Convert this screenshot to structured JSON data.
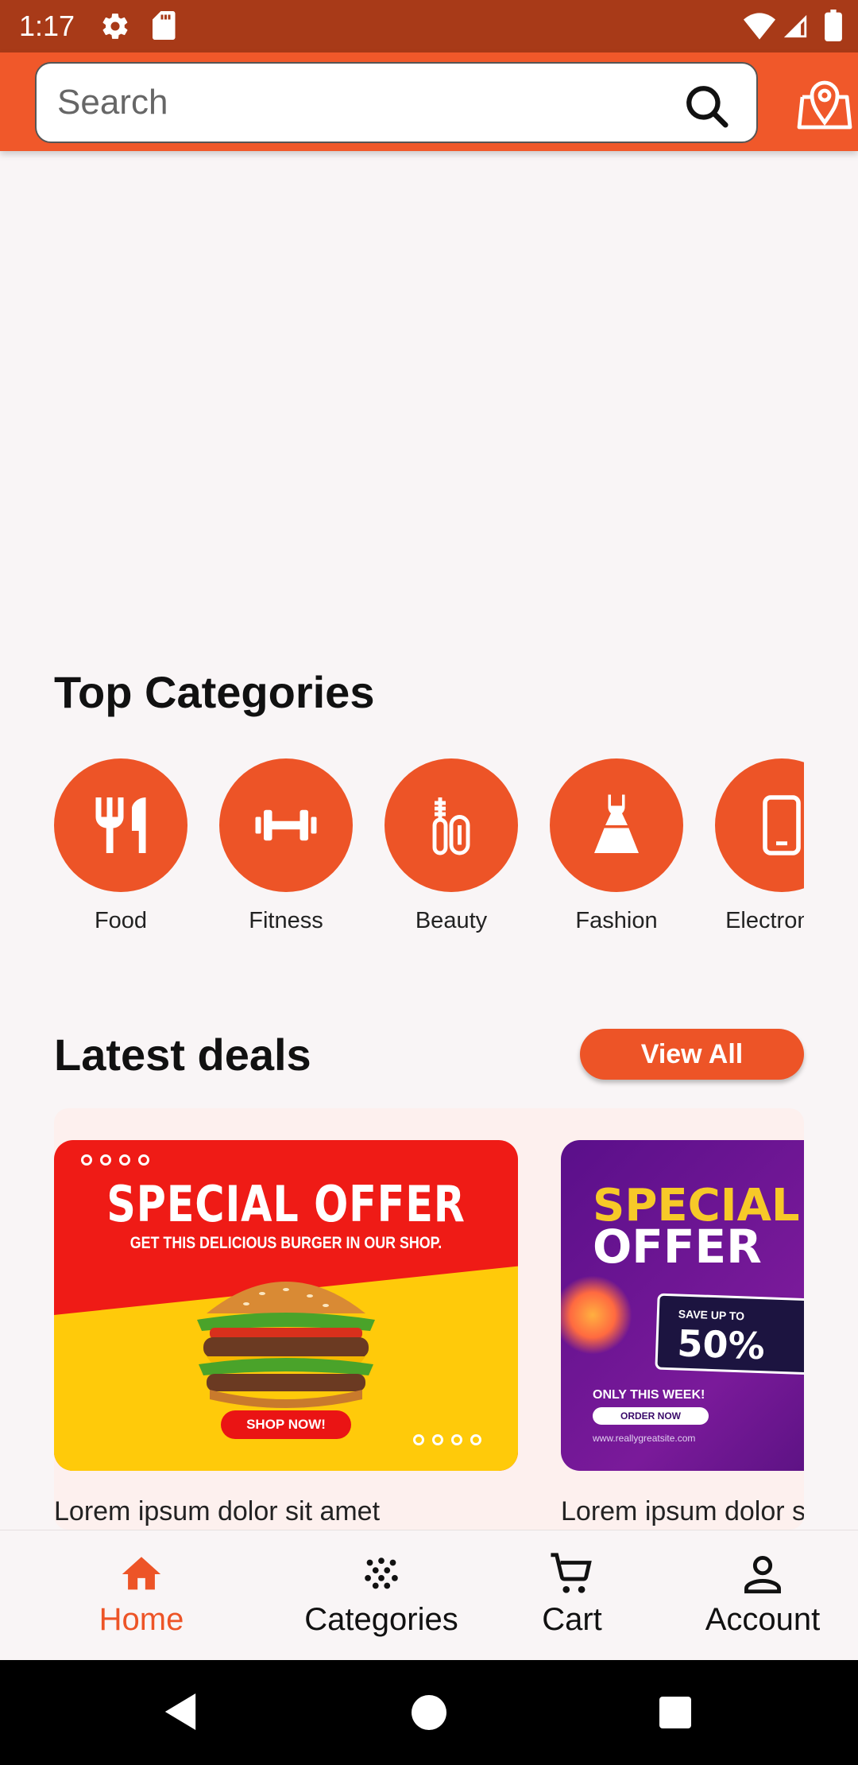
{
  "status_bar": {
    "time": "1:17",
    "icons": [
      "gear-icon",
      "sd-card-icon",
      "wifi-icon",
      "signal-icon",
      "battery-icon"
    ]
  },
  "header": {
    "search_placeholder": "Search",
    "icons": [
      "search-icon",
      "map-location-icon"
    ],
    "accent_color": "#f0582a"
  },
  "top_categories": {
    "title": "Top Categories",
    "items": [
      {
        "label": "Food",
        "icon": "fork-knife-icon"
      },
      {
        "label": "Fitness",
        "icon": "dumbbell-icon"
      },
      {
        "label": "Beauty",
        "icon": "makeup-icon"
      },
      {
        "label": "Fashion",
        "icon": "dress-icon"
      },
      {
        "label": "Electronics",
        "icon": "phone-icon"
      }
    ],
    "circle_color": "#ed5427"
  },
  "latest_deals": {
    "title": "Latest deals",
    "view_all_label": "View All",
    "cards": [
      {
        "headline": "SPECIAL OFFER",
        "subline": "GET THIS DELICIOUS BURGER IN OUR SHOP.",
        "cta": "SHOP NOW!",
        "caption": "Lorem ipsum dolor sit amet"
      },
      {
        "headline_line1": "SPECIAL",
        "headline_line2": "OFFER",
        "save_label": "SAVE UP TO",
        "save_value": "50%",
        "only_label": "ONLY THIS WEEK!",
        "order_label": "ORDER NOW",
        "site": "www.reallygreatsite.com",
        "caption": "Lorem ipsum dolor sit amet"
      }
    ]
  },
  "bottom_nav": {
    "items": [
      {
        "label": "Home",
        "icon": "home-icon",
        "active": true
      },
      {
        "label": "Categories",
        "icon": "categories-icon",
        "active": false
      },
      {
        "label": "Cart",
        "icon": "cart-icon",
        "active": false
      },
      {
        "label": "Account",
        "icon": "account-icon",
        "active": false
      }
    ],
    "active_color": "#ed5427"
  },
  "system_nav": {
    "icons": [
      "back-icon",
      "home-circle-icon",
      "recents-icon"
    ]
  }
}
